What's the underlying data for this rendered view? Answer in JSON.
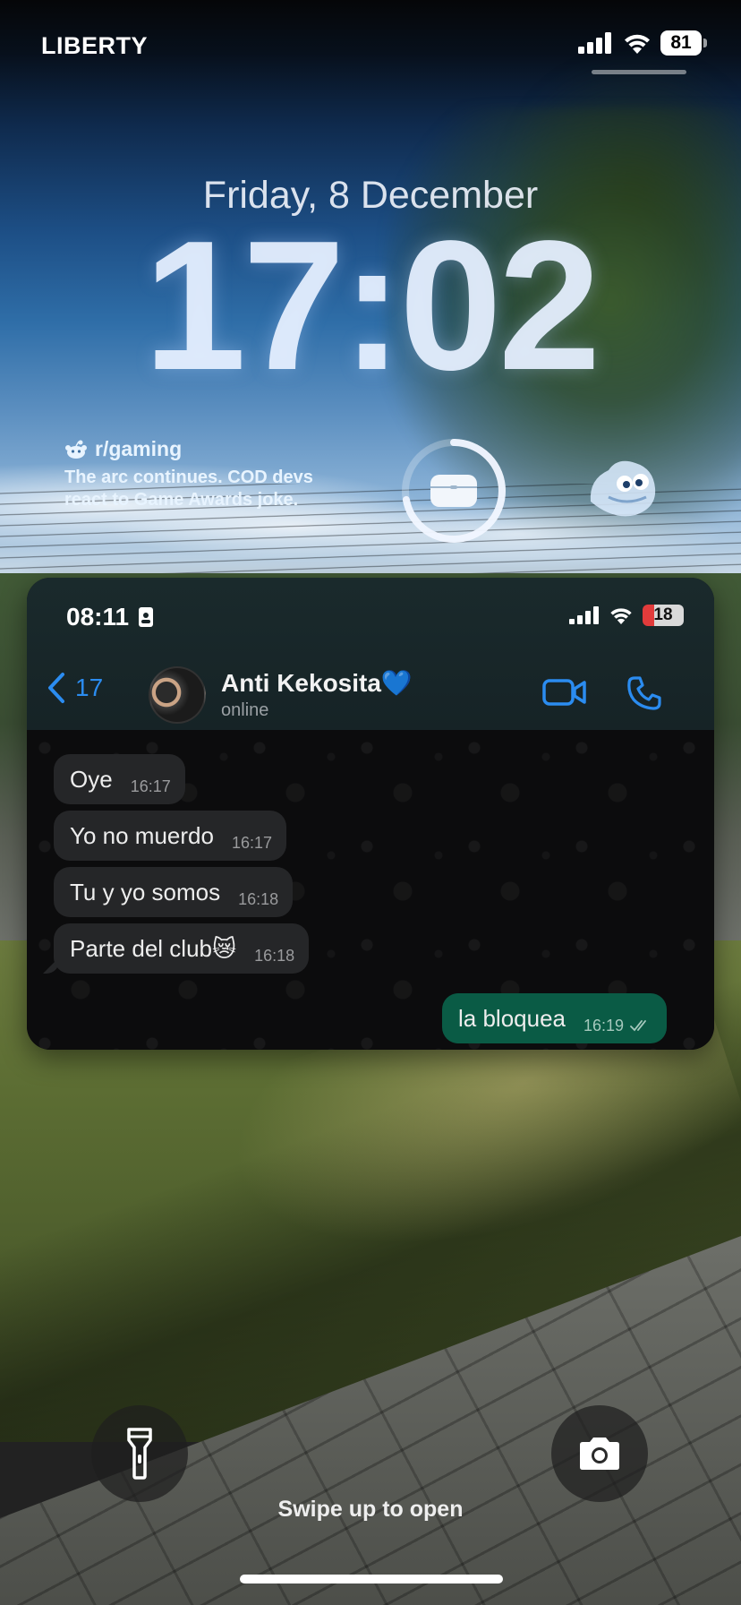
{
  "status_bar": {
    "carrier": "LIBERTY",
    "battery": "81"
  },
  "lock_screen": {
    "date": "Friday, 8 December",
    "time": "17:02",
    "swipe_hint": "Swipe up to open"
  },
  "widgets": {
    "reddit": {
      "subreddit": "r/gaming",
      "headline": "The arc continues. COD devs react to Game Awards joke."
    },
    "battery_ring": {
      "device_icon": "airpods-case-icon",
      "level": 0.72
    },
    "game": {
      "icon": "game-character-icon"
    }
  },
  "whatsapp_card": {
    "status_time": "08:11",
    "status_battery": "18",
    "back_count": "17",
    "contact_name": "Anti Kekosita💙",
    "contact_status": "online",
    "messages": [
      {
        "text": "Oye",
        "time": "16:17",
        "direction": "in"
      },
      {
        "text": "Yo no muerdo",
        "time": "16:17",
        "direction": "in"
      },
      {
        "text": "Tu y yo somos",
        "time": "16:18",
        "direction": "in"
      },
      {
        "text": "Parte del club😿",
        "time": "16:18",
        "direction": "in"
      },
      {
        "text": "la bloquea",
        "time": "16:19",
        "direction": "out"
      }
    ]
  },
  "controls": {
    "left": "flashlight-icon",
    "right": "camera-icon"
  },
  "colors": {
    "accent_blue": "#2b8cf0",
    "outgoing_bubble": "#0a5b45",
    "incoming_bubble": "#252628"
  }
}
